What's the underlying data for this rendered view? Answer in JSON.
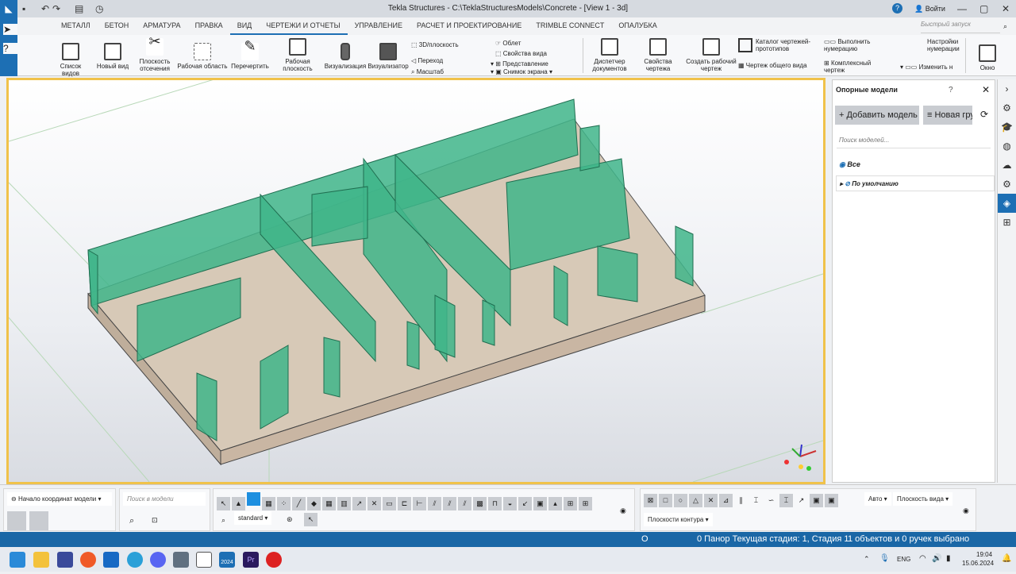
{
  "titlebar": {
    "title": "Tekla Structures - C:\\TeklaStructuresModels\\Concrete  - [View 1 - 3d]",
    "login": "Войти",
    "help_icon": "?"
  },
  "tabs": [
    "МЕТАЛЛ",
    "БЕТОН",
    "АРМАТУРА",
    "ПРАВКА",
    "ВИД",
    "ЧЕРТЕЖИ И ОТЧЕТЫ",
    "УПРАВЛЕНИЕ",
    "РАСЧЕТ И ПРОЕКТИРОВАНИЕ",
    "TRIMBLE CONNECT",
    "ОПАЛУБКА"
  ],
  "active_tab": "ВИД",
  "quick_launch": {
    "placeholder": "Быстрый запуск"
  },
  "ribbon": {
    "big": [
      "Список видов",
      "Новый вид",
      "Плоскость отсечения",
      "Рабочая область",
      "Перечертить",
      "Рабочая плоскость",
      "Визуализация",
      "Визуализатор"
    ],
    "small1": [
      "3D/плоскость",
      "Переход",
      "Масштаб"
    ],
    "small2": [
      "Облет",
      "Свойства вида",
      "Представление",
      "Снимок экрана"
    ],
    "drawing": [
      "Диспетчер документов",
      "Свойства чертежа",
      "Создать рабочий чертеж"
    ],
    "drawing_small": [
      "Каталог чертежей-прототипов",
      "Чертеж общего вида",
      "Выполнить нумерацию",
      "Комплексный чертеж",
      "Настройки нумерации",
      "Изменить н"
    ],
    "window": "Окно"
  },
  "panel": {
    "title": "Опорные модели",
    "add_model": "+ Добавить модель",
    "new_group": "≡ Новая гру",
    "search_placeholder": "Поиск моделей...",
    "all": "Все",
    "default": "По умолчанию"
  },
  "bottom": {
    "origin": "Начало координат модели",
    "model_search_placeholder": "Поиск в модели",
    "standard": "standard",
    "auto": "Авто",
    "view_plane": "Плоскость вида",
    "contour_planes": "Плоскости контура"
  },
  "status": {
    "o": "O",
    "text": "0 Панор Текущая стадия: 1, Стадия 1",
    "selection": "1 объектов и 0 ручек выбрано"
  },
  "taskbar": {
    "lang": "ENG",
    "time": "19:04",
    "date": "15.06.2024",
    "tekla_badge": "2024"
  },
  "colors": {
    "accent": "#1d6fb4",
    "wall": "#3fb58a",
    "viewport_border": "#f0c24a"
  }
}
